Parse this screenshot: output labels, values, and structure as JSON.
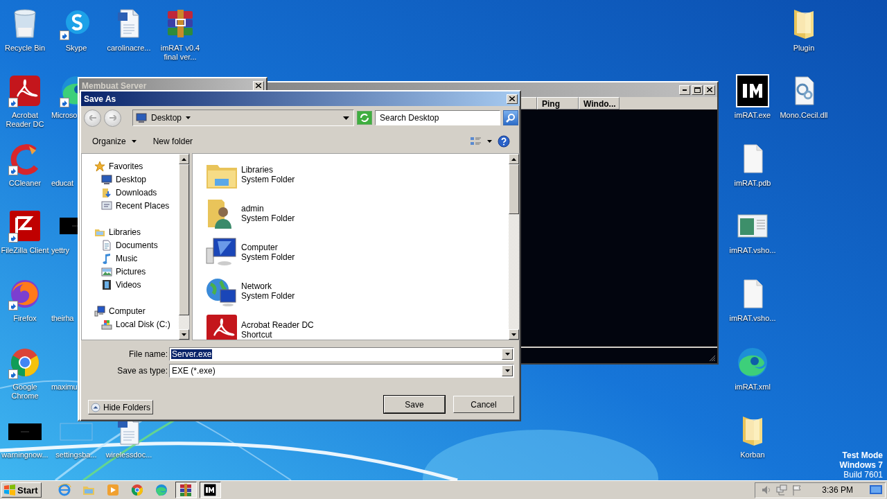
{
  "desktop": {
    "icons": [
      {
        "label": "Recycle Bin",
        "kind": "recycle",
        "shortcut": false
      },
      {
        "label": "Skype",
        "kind": "skype",
        "shortcut": true
      },
      {
        "label": "carolinacre...",
        "kind": "word",
        "shortcut": false
      },
      {
        "label": "imRAT v0.4 final ver...",
        "kind": "winrar",
        "shortcut": false
      },
      {
        "label": "Acrobat Reader DC",
        "kind": "acrobat",
        "shortcut": true
      },
      {
        "label": "Microso",
        "kind": "edge",
        "shortcut": true
      },
      {
        "label": "CCleaner",
        "kind": "ccleaner",
        "shortcut": true
      },
      {
        "label": "educat",
        "kind": "blank",
        "shortcut": false
      },
      {
        "label": "FileZilla Client",
        "kind": "filezilla",
        "shortcut": true
      },
      {
        "label": "yettry",
        "kind": "dark",
        "shortcut": false
      },
      {
        "label": "Firefox",
        "kind": "firefox",
        "shortcut": true
      },
      {
        "label": "theirha",
        "kind": "blank",
        "shortcut": false
      },
      {
        "label": "Google Chrome",
        "kind": "chrome",
        "shortcut": true
      },
      {
        "label": "maximu",
        "kind": "blank",
        "shortcut": false
      },
      {
        "label": "warningnow...",
        "kind": "dark",
        "shortcut": false
      },
      {
        "label": "settingsba...",
        "kind": "thumb",
        "shortcut": false
      },
      {
        "label": "wirelessdoc...",
        "kind": "word",
        "shortcut": false
      },
      {
        "label": "Plugin",
        "kind": "folder",
        "shortcut": false
      },
      {
        "label": "imRAT.exe",
        "kind": "im",
        "shortcut": false
      },
      {
        "label": "Mono.Cecil.dll",
        "kind": "dll",
        "shortcut": false
      },
      {
        "label": "imRAT.pdb",
        "kind": "file",
        "shortcut": false
      },
      {
        "label": "imRAT.vsho...",
        "kind": "vshost",
        "shortcut": false
      },
      {
        "label": "imRAT.vsho...",
        "kind": "file",
        "shortcut": false
      },
      {
        "label": "imRAT.xml",
        "kind": "edge",
        "shortcut": false
      },
      {
        "label": "Korban",
        "kind": "folder",
        "shortcut": false
      }
    ]
  },
  "imrat_window": {
    "columns": [
      "Ping",
      "Windo..."
    ]
  },
  "server_window": {
    "title": "Membuat Server"
  },
  "save_dialog": {
    "title": "Save As",
    "location": "Desktop",
    "search": {
      "placeholder": "Search Desktop"
    },
    "toolbar": [
      {
        "label": "Organize",
        "menu": true
      },
      {
        "label": "New folder",
        "menu": false
      }
    ],
    "nav": [
      {
        "label": "Favorites",
        "children": [
          {
            "label": "Desktop"
          },
          {
            "label": "Downloads"
          },
          {
            "label": "Recent Places"
          }
        ]
      },
      {
        "label": "Libraries",
        "children": [
          {
            "label": "Documents"
          },
          {
            "label": "Music"
          },
          {
            "label": "Pictures"
          },
          {
            "label": "Videos"
          }
        ]
      },
      {
        "label": "Computer",
        "children": [
          {
            "label": "Local Disk (C:)"
          }
        ]
      }
    ],
    "items": [
      {
        "name": "Libraries",
        "type": "System Folder"
      },
      {
        "name": "admin",
        "type": "System Folder"
      },
      {
        "name": "Computer",
        "type": "System Folder"
      },
      {
        "name": "Network",
        "type": "System Folder"
      },
      {
        "name": "Acrobat Reader DC",
        "type": "Shortcut"
      }
    ],
    "file_name": {
      "label": "File name:",
      "value": "Server.exe",
      "highlighted": true
    },
    "save_type": {
      "label": "Save as type:",
      "value": "EXE (*.exe)"
    },
    "hide_folders": "Hide Folders",
    "buttons": [
      {
        "label": "Save",
        "default": true
      },
      {
        "label": "Cancel",
        "default": false
      }
    ]
  },
  "taskbar": {
    "start": "Start",
    "apps": [
      {
        "pressed": false
      },
      {
        "pressed": false
      },
      {
        "pressed": false
      },
      {
        "pressed": false
      },
      {
        "pressed": false
      },
      {
        "pressed": true
      },
      {
        "pressed": true
      }
    ],
    "clock": "3:36 PM"
  },
  "system_notice": [
    "Test Mode",
    "Windows 7",
    "Build 7601"
  ]
}
